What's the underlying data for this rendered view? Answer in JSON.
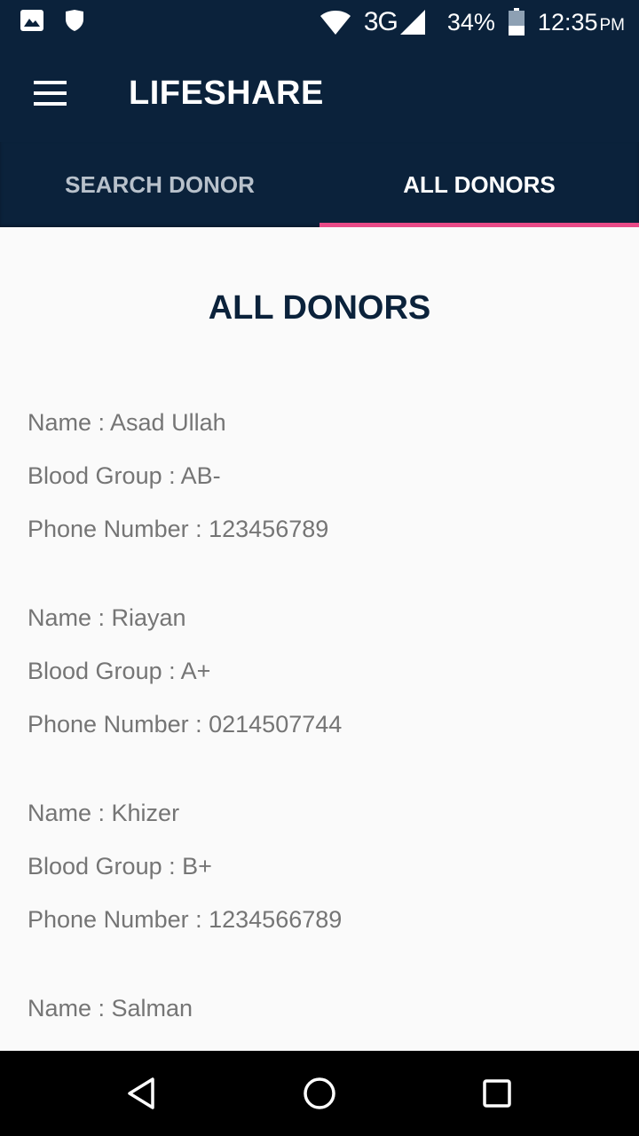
{
  "status_bar": {
    "icons": [
      "image-icon",
      "shield-icon",
      "wifi-icon",
      "signal-icon",
      "battery-icon"
    ],
    "network": "3G",
    "battery": "34%",
    "time": "12:35",
    "time_suffix": "PM"
  },
  "app_bar": {
    "title": "LIFESHARE",
    "menu_icon": "hamburger-menu-icon",
    "background": "#0b223b"
  },
  "tabs": [
    {
      "label": "SEARCH DONOR",
      "active": false
    },
    {
      "label": "ALL DONORS",
      "active": true
    }
  ],
  "tab_indicator_color": "#e94a87",
  "page": {
    "heading": "ALL DONORS"
  },
  "donors": [
    {
      "name": "Name : Asad Ullah",
      "blood_group": "Blood Group : AB-",
      "phone": "Phone Number : 123456789"
    },
    {
      "name": "Name : Riayan",
      "blood_group": "Blood Group : A+",
      "phone": "Phone Number : 0214507744"
    },
    {
      "name": "Name : Khizer",
      "blood_group": "Blood Group : B+",
      "phone": "Phone Number : 1234566789"
    },
    {
      "name": "Name : Salman"
    }
  ],
  "nav_bar": {
    "icons": [
      "back-icon",
      "home-icon",
      "recents-icon"
    ]
  }
}
